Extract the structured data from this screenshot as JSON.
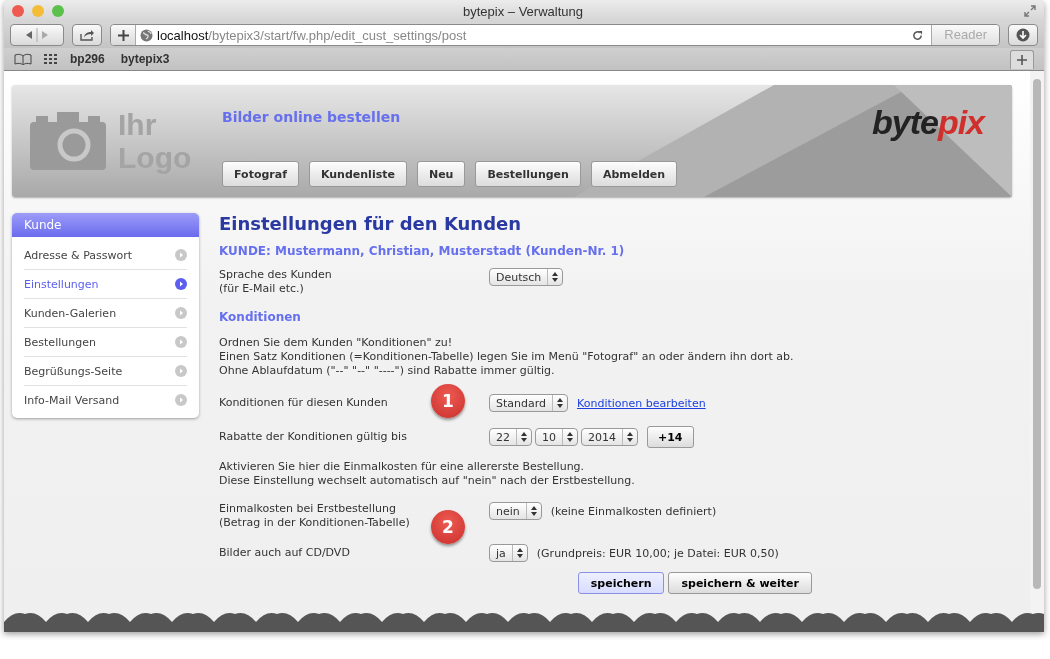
{
  "window": {
    "title": "bytepix – Verwaltung"
  },
  "toolbar": {
    "url_host": "localhost",
    "url_path": "/bytepix3/start/fw.php/edit_cust_settings/post",
    "reader": "Reader"
  },
  "bookmarks": [
    "bp296",
    "bytepix3"
  ],
  "header": {
    "logo_lines": [
      "Ihr",
      "Logo"
    ],
    "tagline": "Bilder online bestellen",
    "brand_first": "byte",
    "brand_second": "pix",
    "nav_buttons": [
      "Fotograf",
      "Kundenliste",
      "Neu",
      "Bestellungen",
      "Abmelden"
    ]
  },
  "sidebar": {
    "title": "Kunde",
    "items": [
      {
        "label": "Adresse & Passwort",
        "selected": false
      },
      {
        "label": "Einstellungen",
        "selected": true
      },
      {
        "label": "Kunden-Galerien",
        "selected": false
      },
      {
        "label": "Bestellungen",
        "selected": false
      },
      {
        "label": "Begrüßungs-Seite",
        "selected": false
      },
      {
        "label": "Info-Mail Versand",
        "selected": false
      }
    ]
  },
  "main": {
    "title": "Einstellungen für den Kunden",
    "customer": "KUNDE: Mustermann, Christian, Musterstadt (Kunden-Nr. 1)",
    "blocks": [
      {
        "kind": "field",
        "label": "Sprache des Kunden\n(für E-Mail etc.)",
        "selects": [
          "Deutsch"
        ]
      },
      {
        "kind": "heading",
        "text": "Konditionen"
      },
      {
        "kind": "text",
        "text": "Ordnen Sie dem Kunden \"Konditionen\" zu!\nEinen Satz Konditionen (=Konditionen-Tabelle) legen Sie im Menü \"Fotograf\" an oder ändern ihn dort ab.\nOhne Ablaufdatum (\"--\" \"--\" \"----\") sind Rabatte immer gültig."
      },
      {
        "kind": "field",
        "label": "Konditionen für diesen Kunden",
        "selects": [
          "Standard"
        ],
        "link": "Konditionen bearbeiten",
        "marker": "1"
      },
      {
        "kind": "field",
        "label": "Rabatte der Konditionen gültig bis",
        "selects": [
          "22",
          "10",
          "2014"
        ],
        "button": "+14"
      },
      {
        "kind": "text",
        "text": "Aktivieren Sie hier die Einmalkosten für eine allererste Bestellung.\nDiese Einstellung wechselt automatisch auf \"nein\" nach der Erstbestellung."
      },
      {
        "kind": "field",
        "label": "Einmalkosten bei Erstbestellung\n(Betrag in der Konditionen-Tabelle)",
        "selects": [
          "nein"
        ],
        "note": "(keine Einmalkosten definiert)",
        "marker": "2"
      },
      {
        "kind": "field",
        "label": "Bilder auch auf CD/DVD",
        "selects": [
          "ja"
        ],
        "note": "(Grundpreis: EUR 10,00; je Datei: EUR 0,50)"
      }
    ],
    "buttons": [
      {
        "label": "speichern",
        "selected": true
      },
      {
        "label": "speichern & weiter",
        "selected": false
      }
    ]
  }
}
